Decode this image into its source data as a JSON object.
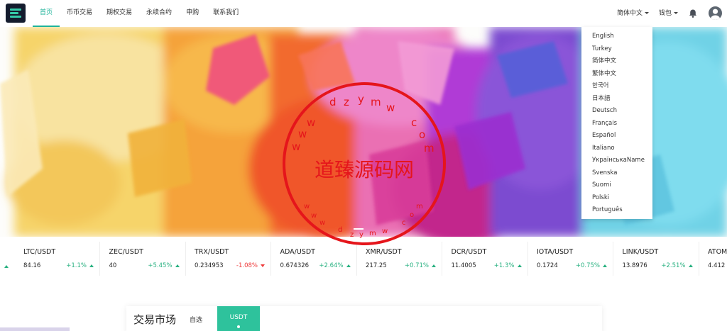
{
  "nav": {
    "items": [
      "首页",
      "币币交易",
      "期权交易",
      "永续合约",
      "申购",
      "联系我们"
    ]
  },
  "header": {
    "language_label": "简体中文",
    "wallet_label": "钱包"
  },
  "language_menu": {
    "options": [
      "English",
      "Turkey",
      "简体中文",
      "繁体中文",
      "한국어",
      "日本語",
      "Deutsch",
      "Français",
      "Español",
      "Italiano",
      "УкраїнськаName",
      "Svenska",
      "Suomi",
      "Polski",
      "Português"
    ]
  },
  "watermark": {
    "main_text": "道臻源码网",
    "arc_text": "wwwdzymwcom"
  },
  "ticker": [
    {
      "pair": "LTC/USDT",
      "price": "84.16",
      "change": "+1.1%",
      "direction": "up"
    },
    {
      "pair": "ZEC/USDT",
      "price": "40",
      "change": "+5.45%",
      "direction": "up"
    },
    {
      "pair": "TRX/USDT",
      "price": "0.234953",
      "change": "-1.08%",
      "direction": "down"
    },
    {
      "pair": "ADA/USDT",
      "price": "0.674326",
      "change": "+2.64%",
      "direction": "up"
    },
    {
      "pair": "XMR/USDT",
      "price": "217.25",
      "change": "+0.71%",
      "direction": "up"
    },
    {
      "pair": "DCR/USDT",
      "price": "11.4005",
      "change": "+1.3%",
      "direction": "up"
    },
    {
      "pair": "IOTA/USDT",
      "price": "0.1724",
      "change": "+0.75%",
      "direction": "up"
    },
    {
      "pair": "LINK/USDT",
      "price": "13.8976",
      "change": "+2.51%",
      "direction": "up"
    },
    {
      "pair": "ATOM",
      "price": "4.412",
      "change": "",
      "direction": "up"
    }
  ],
  "market": {
    "title": "交易市场",
    "favorites_label": "自选",
    "active_tab": "USDT"
  },
  "colors": {
    "accent": "#1fb39a",
    "up": "#26b07f",
    "down": "#ee3a3a",
    "stamp": "#e5151b"
  }
}
